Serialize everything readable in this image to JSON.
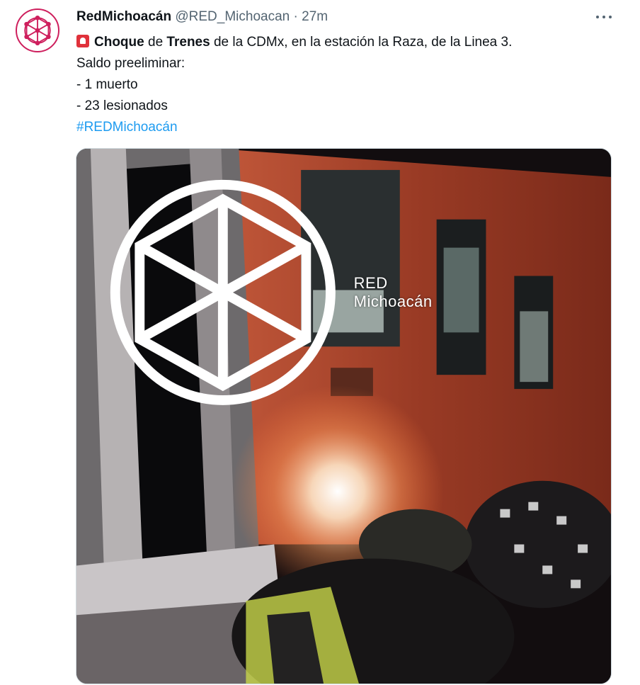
{
  "tweet": {
    "author_name": "RedMichoacán",
    "handle": "@RED_Michoacan",
    "separator": "·",
    "time": "27m",
    "alert_icon": "rotating-light-icon",
    "text": {
      "line1": {
        "w1": "Choque",
        "t1": " de ",
        "w2": "Trenes",
        "t2": " de la CDMx, en la estación la Raza, de la Linea 3."
      },
      "line2": "Saldo preeliminar:",
      "line3": "- 1 muerto",
      "line4": "- 23 lesionados"
    },
    "hashtag": "#REDMichoacán"
  },
  "media": {
    "watermark": "RED Michoacán"
  },
  "colors": {
    "brand": "#ce1f5d",
    "link": "#1d9bf0",
    "secondary_text": "#536471",
    "alert": "#e0313b"
  }
}
